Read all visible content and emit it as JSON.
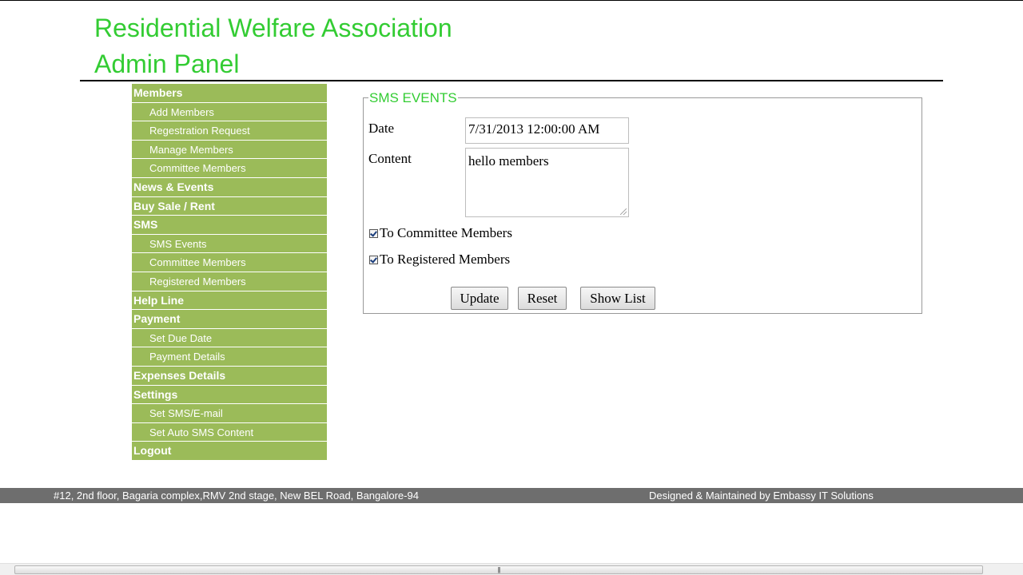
{
  "header": {
    "title_line1": "Residential Welfare Association",
    "title_line2": "Admin Panel",
    "color": "#33cc33"
  },
  "sidebar": {
    "color": "#9bbb59",
    "items": [
      {
        "label": "Members",
        "level": "top"
      },
      {
        "label": "Add Members",
        "level": "sub"
      },
      {
        "label": "Regestration Request",
        "level": "sub"
      },
      {
        "label": "Manage Members",
        "level": "sub"
      },
      {
        "label": "Committee Members",
        "level": "sub"
      },
      {
        "label": "News & Events",
        "level": "top"
      },
      {
        "label": "Buy Sale / Rent",
        "level": "top"
      },
      {
        "label": "SMS",
        "level": "top"
      },
      {
        "label": "SMS Events",
        "level": "sub"
      },
      {
        "label": "Committee Members",
        "level": "sub"
      },
      {
        "label": "Registered Members",
        "level": "sub"
      },
      {
        "label": "Help Line",
        "level": "top"
      },
      {
        "label": "Payment",
        "level": "top"
      },
      {
        "label": "Set Due Date",
        "level": "sub"
      },
      {
        "label": "Payment Details",
        "level": "sub"
      },
      {
        "label": "Expenses Details",
        "level": "top"
      },
      {
        "label": "Settings",
        "level": "top"
      },
      {
        "label": "Set SMS/E-mail",
        "level": "sub"
      },
      {
        "label": "Set Auto SMS Content",
        "level": "sub"
      },
      {
        "label": "Logout",
        "level": "top"
      }
    ]
  },
  "form": {
    "legend": "SMS EVENTS",
    "date_label": "Date",
    "date_value": "7/31/2013 12:00:00 AM",
    "content_label": "Content",
    "content_value": "hello members",
    "checkbox_committee_label": "To Committee Members",
    "checkbox_committee_checked": true,
    "checkbox_registered_label": "To Registered Members",
    "checkbox_registered_checked": true,
    "update_label": "Update",
    "reset_label": "Reset",
    "show_list_label": "Show List"
  },
  "footer": {
    "address": "#12, 2nd floor, Bagaria complex,RMV 2nd stage, New BEL Road, Bangalore-94",
    "credit": "Designed & Maintained by Embassy IT Solutions"
  }
}
